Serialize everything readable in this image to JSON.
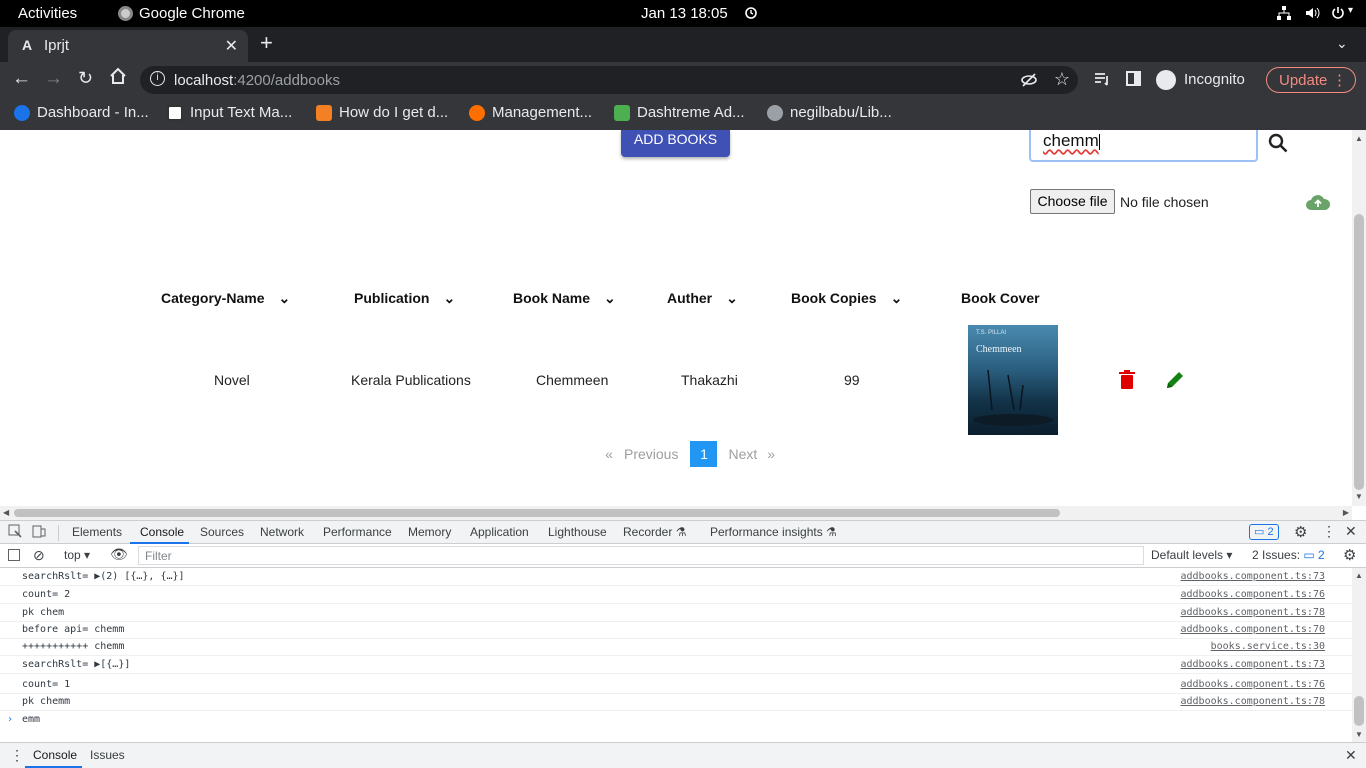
{
  "system_bar": {
    "activities": "Activities",
    "app": "Google Chrome",
    "clock": "Jan 13  18:05"
  },
  "tab": {
    "title": "Iprjt"
  },
  "omnibox": {
    "host": "localhost",
    "path": ":4200/addbooks"
  },
  "toolbar": {
    "profile": "Incognito",
    "update": "Update"
  },
  "bookmarks": [
    {
      "label": "Dashboard - In...",
      "color": "#1a73e8"
    },
    {
      "label": "Input Text Ma...",
      "color": "#ffffff"
    },
    {
      "label": "How do I get d...",
      "color": "#f48024"
    },
    {
      "label": "Management...",
      "color": "#ff6f00"
    },
    {
      "label": "Dashtreme Ad...",
      "color": "#4caf50"
    },
    {
      "label": "negilbabu/Lib...",
      "color": "#9aa0a6"
    }
  ],
  "page": {
    "add_books_label": "ADD BOOKS",
    "search_value": "chemm",
    "choose_file_label": "Choose file",
    "no_file_text": "No file chosen",
    "columns": [
      "Category-Name",
      "Publication",
      "Book Name",
      "Auther",
      "Book Copies",
      "Book Cover"
    ],
    "row": {
      "category": "Novel",
      "publication": "Kerala Publications",
      "book_name": "Chemmeen",
      "auther": "Thakazhi",
      "copies": "99"
    },
    "cover": {
      "author_text": "T.S. PILLAI",
      "title_text": "Chemmeen"
    },
    "pagination": {
      "first": "«",
      "previous": "Previous",
      "current": "1",
      "next": "Next",
      "last": "»"
    },
    "colors": {
      "primary": "#3f51b5",
      "delete": "#e00000",
      "edit": "#128212",
      "page_active": "#2196f3"
    }
  },
  "devtools": {
    "tabs": [
      "Elements",
      "Console",
      "Sources",
      "Network",
      "Performance",
      "Memory",
      "Application",
      "Lighthouse",
      "Recorder ⚗",
      "Performance insights ⚗"
    ],
    "issue_badge": "2",
    "context": "top",
    "filter_placeholder": "Filter",
    "levels": "Default levels ▾",
    "issues": "2 Issues:",
    "issues_count": "2",
    "console_lines": [
      {
        "msg": "searchRslt= ▶(2) [{…}, {…}]",
        "src": "addbooks.component.ts:73"
      },
      {
        "msg": "count= 2",
        "src": "addbooks.component.ts:76"
      },
      {
        "msg": "pk chem",
        "src": "addbooks.component.ts:78"
      },
      {
        "msg": "before api= chemm",
        "src": "addbooks.component.ts:70"
      },
      {
        "msg": "+++++++++++ chemm",
        "src": "books.service.ts:30"
      },
      {
        "msg": "searchRslt= ▶[{…}]",
        "src": "addbooks.component.ts:73"
      },
      {
        "msg": "count= 1",
        "src": "addbooks.component.ts:76"
      },
      {
        "msg": "pk chemm",
        "src": "addbooks.component.ts:78"
      }
    ],
    "prompt_text": "emm",
    "drawer_tabs": [
      "Console",
      "Issues"
    ]
  }
}
